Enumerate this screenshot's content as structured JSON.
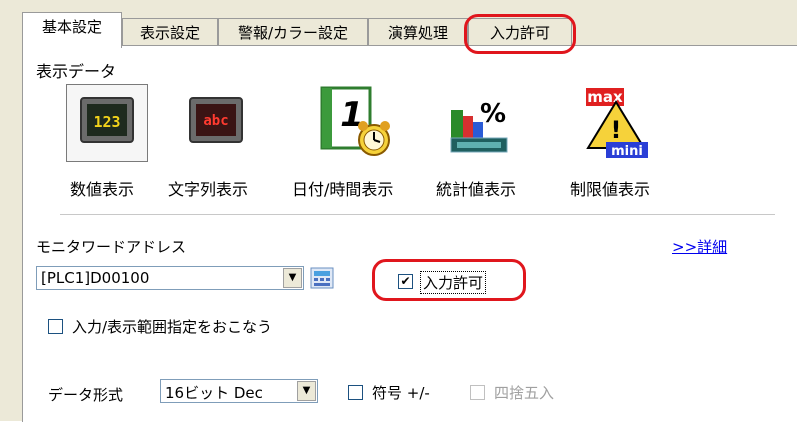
{
  "tabs": [
    {
      "label": "基本設定"
    },
    {
      "label": "表示設定"
    },
    {
      "label": "警報/カラー設定"
    },
    {
      "label": "演算処理"
    },
    {
      "label": "入力許可"
    }
  ],
  "display_data": {
    "heading": "表示データ",
    "items": [
      {
        "label": "数値表示",
        "glyph": "123",
        "icon": "numeric-display-icon"
      },
      {
        "label": "文字列表示",
        "glyph": "abc",
        "icon": "string-display-icon"
      },
      {
        "label": "日付/時間表示",
        "glyph": "1",
        "icon": "date-time-display-icon"
      },
      {
        "label": "統計値表示",
        "glyph": "%",
        "icon": "statistics-display-icon"
      },
      {
        "label": "制限値表示",
        "glyph_top": "max",
        "glyph_bottom": "mini",
        "icon": "limit-display-icon"
      }
    ]
  },
  "monitor": {
    "label": "モニタワードアドレス",
    "address": "[PLC1]D00100",
    "detail_link": ">>詳細"
  },
  "input_permit": {
    "label": "入力許可",
    "checked": true
  },
  "range_option": {
    "label": "入力/表示範囲指定をおこなう",
    "checked": false
  },
  "data_format": {
    "label": "データ形式",
    "value": "16ビット Dec",
    "sign_label": "符号 +/-",
    "round_label": "四捨五入"
  },
  "colors": {
    "highlight_ring": "#e0161d",
    "link": "#0000ee"
  }
}
